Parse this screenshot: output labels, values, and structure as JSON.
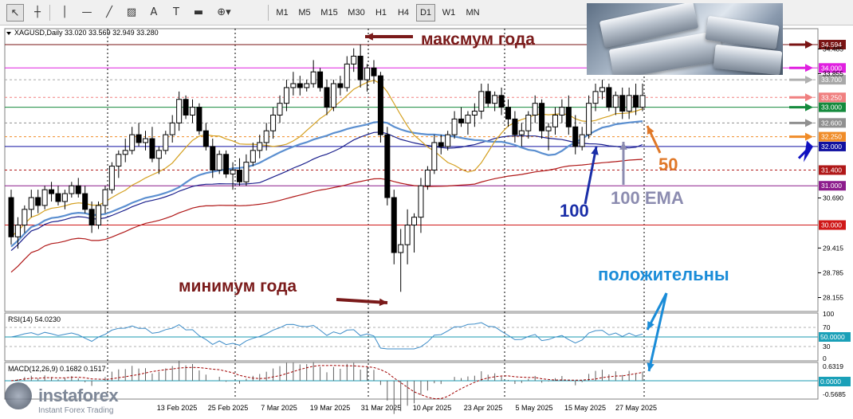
{
  "toolbar": {
    "tools": [
      {
        "name": "cursor-icon",
        "glyph": "↖",
        "active": true
      },
      {
        "name": "crosshair-icon",
        "glyph": "┼",
        "active": false
      },
      {
        "name": "vertical-line-icon",
        "glyph": "│",
        "active": false
      },
      {
        "name": "horizontal-line-icon",
        "glyph": "—",
        "active": false
      },
      {
        "name": "trendline-icon",
        "glyph": "╱",
        "active": false
      },
      {
        "name": "channel-icon",
        "glyph": "▨",
        "active": false
      },
      {
        "name": "text-tool-icon",
        "glyph": "A",
        "active": false
      },
      {
        "name": "text-label-icon",
        "glyph": "T",
        "active": false
      },
      {
        "name": "rectangle-icon",
        "glyph": "▬",
        "active": false
      },
      {
        "name": "shapes-menu-icon",
        "glyph": "⊕▾",
        "active": false
      }
    ],
    "timeframes": [
      "M1",
      "M5",
      "M15",
      "M30",
      "H1",
      "H4",
      "D1",
      "W1",
      "MN"
    ],
    "active_timeframe": "D1"
  },
  "header_text": "XAGUSD,Daily  33.020 33.569 32.949 33.280",
  "indicators": {
    "rsi_label": "RSI(14) 54.0230",
    "macd_label": "MACD(12,26,9) 0.1682 0.1517"
  },
  "annotations": {
    "year_max": "максмум года",
    "year_min": "минимум года",
    "ma50": "50",
    "ma100": "100",
    "ema100": "100 EMA",
    "positive": "положительны"
  },
  "logo": {
    "word": "instaforex",
    "sub": "Instant Forex Trading"
  },
  "colors": {
    "candle": "#000000",
    "ma50": "#d4a020",
    "ma100": "#1a1f8c",
    "ema100": "#5b8fd0",
    "ma200": "#b01818",
    "rsi": "#3c8cc8",
    "signal": "#a00000",
    "annot_dark": "#7a1a1a",
    "annot_blue": "#1a2ea8",
    "annot_orange": "#e07828",
    "annot_gray": "#8c8cb0",
    "annot_cyan": "#1a8cd8"
  },
  "chart_data": {
    "type": "candlestick",
    "symbol": "XAGUSD",
    "timeframe": "Daily",
    "ylim": [
      27.8,
      35.0
    ],
    "y_ticks": [
      34.485,
      33.855,
      30.69,
      29.415,
      28.785,
      28.155
    ],
    "x_tick_labels": [
      "13 Feb 2025",
      "25 Feb 2025",
      "7 Mar 2025",
      "19 Mar 2025",
      "31 Mar 2025",
      "10 Apr 2025",
      "23 Apr 2025",
      "5 May 2025",
      "15 May 2025",
      "27 May 2025"
    ],
    "levels": [
      {
        "label": "34.594",
        "value": 34.594,
        "color": "#7a1414",
        "style": "solid"
      },
      {
        "label": "34.000",
        "value": 34.0,
        "color": "#e020e0",
        "style": "solid"
      },
      {
        "label": "33.700",
        "value": 33.7,
        "color": "#a8a8a8",
        "style": "dashed"
      },
      {
        "label": "33.250",
        "value": 33.25,
        "color": "#f08080",
        "style": "dashed"
      },
      {
        "label": "33.000",
        "value": 33.0,
        "color": "#148a3c",
        "style": "solid"
      },
      {
        "label": "32.600",
        "value": 32.6,
        "color": "#909090",
        "style": "dashed"
      },
      {
        "label": "32.250",
        "value": 32.25,
        "color": "#f08c28",
        "style": "dashed"
      },
      {
        "label": "32.000",
        "value": 32.0,
        "color": "#1010a0",
        "style": "solid"
      },
      {
        "label": "31.400",
        "value": 31.4,
        "color": "#b01818",
        "style": "dashed"
      },
      {
        "label": "31.000",
        "value": 31.0,
        "color": "#8c1c8c",
        "style": "solid"
      },
      {
        "label": "30.000",
        "value": 30.0,
        "color": "#d01818",
        "style": "solid"
      }
    ],
    "candles": [
      [
        30.7,
        30.9,
        29.5,
        29.7
      ],
      [
        29.7,
        30.2,
        29.4,
        30.0
      ],
      [
        30.0,
        30.5,
        29.8,
        30.4
      ],
      [
        30.4,
        30.9,
        30.2,
        30.7
      ],
      [
        30.7,
        30.9,
        30.3,
        30.5
      ],
      [
        30.5,
        31.0,
        30.4,
        30.9
      ],
      [
        30.9,
        31.1,
        30.6,
        30.8
      ],
      [
        30.8,
        31.0,
        30.5,
        30.6
      ],
      [
        30.6,
        30.9,
        30.4,
        30.8
      ],
      [
        30.8,
        31.1,
        30.7,
        31.0
      ],
      [
        31.0,
        31.2,
        30.7,
        30.8
      ],
      [
        30.8,
        31.0,
        30.3,
        30.4
      ],
      [
        30.4,
        30.6,
        29.8,
        30.0
      ],
      [
        30.0,
        30.6,
        29.9,
        30.5
      ],
      [
        30.5,
        31.0,
        30.3,
        30.9
      ],
      [
        30.9,
        31.6,
        30.8,
        31.5
      ],
      [
        31.5,
        31.9,
        31.2,
        31.8
      ],
      [
        31.8,
        32.2,
        31.6,
        31.9
      ],
      [
        31.9,
        32.5,
        31.8,
        32.3
      ],
      [
        32.3,
        32.6,
        32.0,
        32.1
      ],
      [
        32.1,
        32.4,
        31.9,
        32.2
      ],
      [
        32.2,
        32.5,
        31.6,
        31.7
      ],
      [
        31.7,
        32.0,
        31.3,
        31.9
      ],
      [
        31.9,
        32.4,
        31.8,
        32.3
      ],
      [
        32.3,
        32.8,
        32.1,
        32.6
      ],
      [
        32.6,
        33.4,
        32.4,
        33.2
      ],
      [
        33.2,
        33.3,
        32.7,
        32.8
      ],
      [
        32.8,
        33.2,
        32.6,
        33.0
      ],
      [
        33.0,
        33.1,
        32.3,
        32.4
      ],
      [
        32.4,
        32.6,
        31.9,
        32.0
      ],
      [
        32.0,
        32.2,
        31.2,
        31.4
      ],
      [
        31.4,
        31.9,
        31.3,
        31.8
      ],
      [
        31.8,
        31.9,
        31.2,
        31.3
      ],
      [
        31.3,
        31.6,
        30.9,
        31.4
      ],
      [
        31.4,
        31.7,
        31.0,
        31.1
      ],
      [
        31.1,
        31.8,
        31.0,
        31.6
      ],
      [
        31.6,
        32.1,
        31.5,
        31.9
      ],
      [
        31.9,
        32.3,
        31.7,
        32.1
      ],
      [
        32.1,
        32.6,
        31.9,
        32.4
      ],
      [
        32.4,
        33.0,
        32.2,
        32.8
      ],
      [
        32.8,
        33.3,
        32.6,
        33.1
      ],
      [
        33.1,
        33.7,
        32.9,
        33.5
      ],
      [
        33.5,
        33.9,
        33.3,
        33.6
      ],
      [
        33.6,
        33.8,
        33.3,
        33.5
      ],
      [
        33.5,
        33.7,
        33.4,
        33.6
      ],
      [
        33.6,
        34.2,
        33.5,
        33.9
      ],
      [
        33.9,
        34.0,
        33.4,
        33.5
      ],
      [
        33.5,
        33.7,
        32.8,
        33.0
      ],
      [
        33.0,
        33.7,
        32.9,
        33.6
      ],
      [
        33.6,
        33.8,
        33.3,
        33.5
      ],
      [
        33.5,
        34.3,
        33.4,
        34.1
      ],
      [
        34.1,
        34.5,
        33.9,
        34.3
      ],
      [
        34.3,
        34.6,
        33.5,
        33.7
      ],
      [
        33.7,
        34.1,
        33.4,
        34.0
      ],
      [
        34.0,
        34.2,
        33.6,
        33.8
      ],
      [
        33.8,
        33.9,
        32.1,
        32.3
      ],
      [
        32.3,
        32.5,
        30.5,
        30.7
      ],
      [
        30.7,
        30.9,
        29.0,
        29.3
      ],
      [
        29.3,
        29.9,
        28.3,
        29.5
      ],
      [
        29.5,
        30.4,
        29.0,
        30.0
      ],
      [
        30.0,
        30.3,
        29.3,
        30.2
      ],
      [
        30.2,
        31.2,
        29.8,
        31.0
      ],
      [
        31.0,
        31.5,
        30.9,
        31.4
      ],
      [
        31.4,
        32.3,
        31.3,
        32.1
      ],
      [
        32.1,
        32.3,
        31.8,
        32.0
      ],
      [
        32.0,
        32.4,
        31.9,
        32.3
      ],
      [
        32.3,
        32.9,
        32.2,
        32.7
      ],
      [
        32.7,
        33.0,
        32.5,
        32.6
      ],
      [
        32.6,
        32.9,
        32.3,
        32.8
      ],
      [
        32.8,
        33.1,
        32.5,
        32.9
      ],
      [
        32.9,
        33.6,
        32.7,
        33.4
      ],
      [
        33.4,
        33.6,
        33.0,
        33.1
      ],
      [
        33.1,
        33.4,
        32.9,
        33.3
      ],
      [
        33.3,
        33.5,
        32.8,
        33.0
      ],
      [
        33.0,
        33.2,
        32.5,
        32.7
      ],
      [
        32.7,
        32.9,
        32.1,
        32.3
      ],
      [
        32.3,
        32.6,
        32.0,
        32.4
      ],
      [
        32.4,
        32.9,
        32.2,
        32.8
      ],
      [
        32.8,
        33.3,
        32.6,
        33.1
      ],
      [
        33.1,
        33.2,
        32.2,
        32.4
      ],
      [
        32.4,
        32.6,
        31.9,
        32.5
      ],
      [
        32.5,
        33.0,
        32.3,
        32.8
      ],
      [
        32.8,
        33.2,
        32.6,
        33.0
      ],
      [
        33.0,
        33.3,
        32.3,
        32.5
      ],
      [
        32.5,
        32.8,
        31.8,
        32.0
      ],
      [
        32.0,
        32.5,
        31.9,
        32.3
      ],
      [
        32.3,
        33.3,
        32.2,
        33.1
      ],
      [
        33.1,
        33.6,
        32.9,
        33.4
      ],
      [
        33.4,
        33.7,
        33.2,
        33.5
      ],
      [
        33.5,
        33.6,
        32.9,
        33.0
      ],
      [
        33.0,
        33.4,
        32.8,
        33.3
      ],
      [
        33.3,
        33.5,
        32.7,
        32.9
      ],
      [
        32.9,
        33.5,
        32.7,
        33.3
      ],
      [
        33.3,
        33.6,
        32.8,
        33.0
      ],
      [
        33.0,
        33.6,
        32.9,
        33.3
      ]
    ],
    "rsi": {
      "ylim": [
        0,
        100
      ],
      "levels": [
        70,
        50,
        30
      ],
      "ticks": [
        "100",
        "70",
        "50.0000",
        "30",
        "0"
      ]
    },
    "macd": {
      "ticks": [
        "0.6319",
        "0.0000",
        "-0.5685"
      ]
    }
  }
}
